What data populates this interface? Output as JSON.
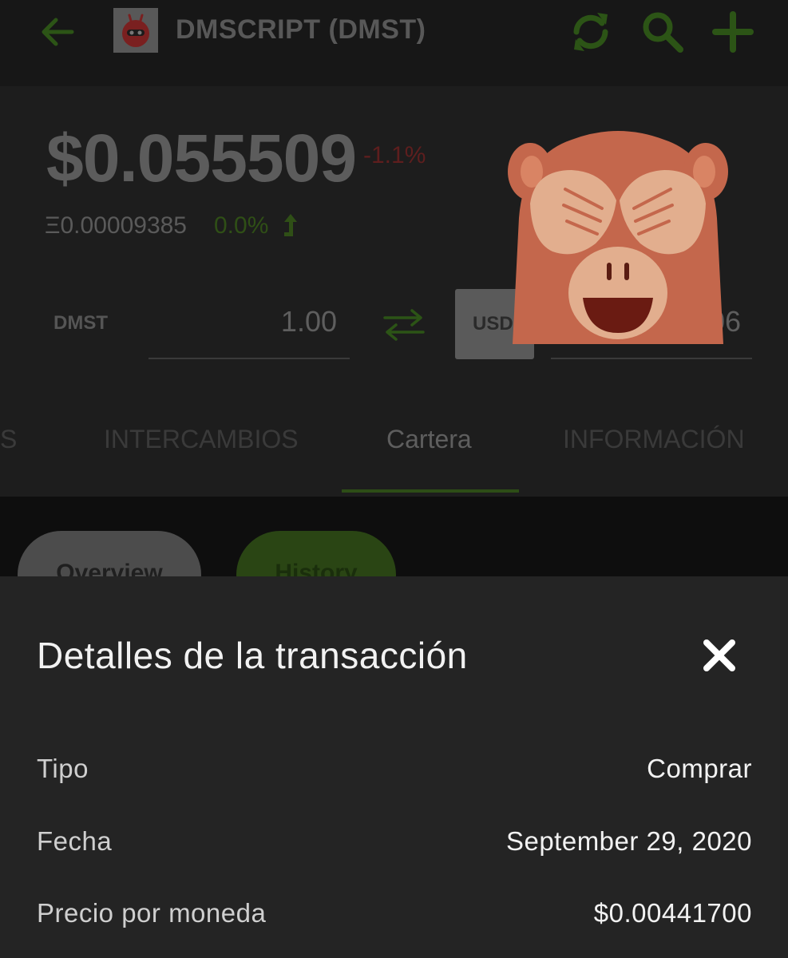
{
  "header": {
    "title": "DMSCRIPT (DMST)",
    "accent_color": "#2e5a17",
    "icons": [
      "back-arrow-icon",
      "refresh-icon",
      "search-icon",
      "plus-icon"
    ]
  },
  "price": {
    "usd": "$0.055509",
    "usd_change": "-1.1%",
    "eth": "Ξ0.00009385",
    "eth_change": "0.0%"
  },
  "converter": {
    "from_label": "DMST",
    "from_value": "1.00",
    "to_currency": "USD",
    "to_value": "06"
  },
  "tabs": [
    {
      "label": "S"
    },
    {
      "label": "INTERCAMBIOS"
    },
    {
      "label": "Cartera",
      "active": true
    },
    {
      "label": "INFORMACIÓN"
    }
  ],
  "subtabs": {
    "overview": "Overview",
    "history": "History"
  },
  "sheet": {
    "title": "Detalles de la transacción",
    "rows": [
      {
        "label": "Tipo",
        "value": "Comprar"
      },
      {
        "label": "Fecha",
        "value": "September 29, 2020"
      },
      {
        "label": "Precio por moneda",
        "value": "$0.00441700"
      }
    ]
  }
}
